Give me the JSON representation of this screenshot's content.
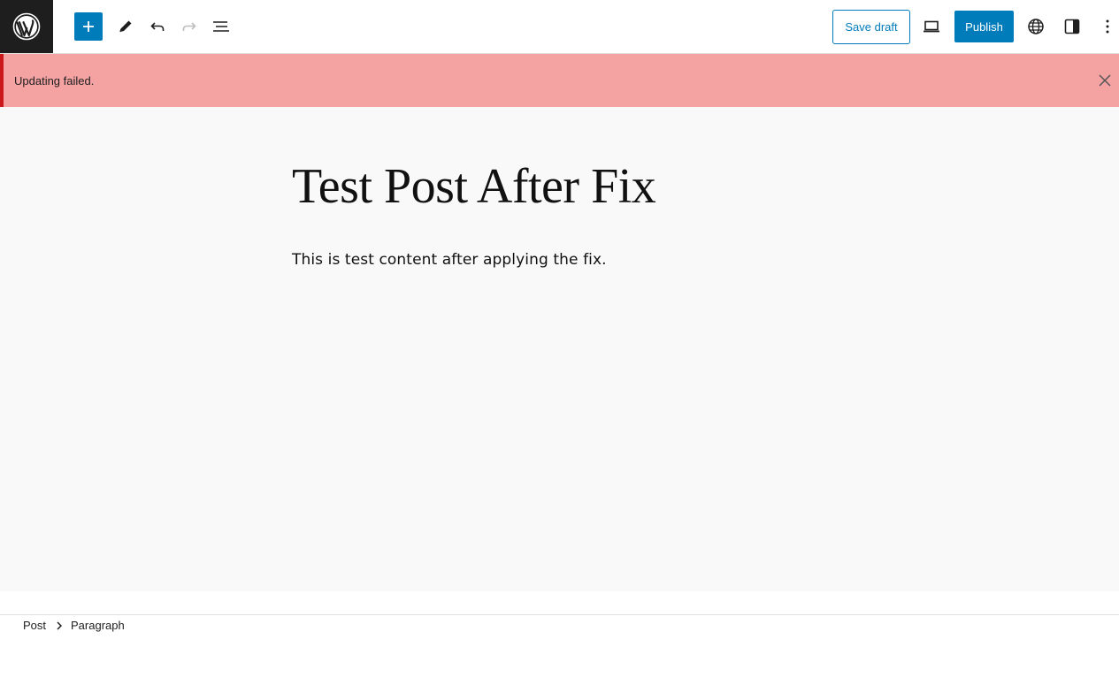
{
  "toolbar": {
    "logo_icon": "wordpress-logo-icon",
    "add_block_icon": "plus-icon",
    "tools_icon": "pencil-icon",
    "undo_icon": "undo-icon",
    "redo_icon": "redo-icon",
    "document_overview_icon": "list-view-icon",
    "save_draft_label": "Save draft",
    "preview_icon": "laptop-icon",
    "publish_label": "Publish",
    "view_site_icon": "globe-icon",
    "settings_icon": "sidebar-toggle-icon",
    "options_icon": "more-vertical-icon",
    "accent_color": "#007cba"
  },
  "notice": {
    "message": "Updating failed.",
    "status": "error",
    "background_color": "#f4a2a2",
    "border_color": "#cc1818",
    "close_icon": "close-icon"
  },
  "editor": {
    "title": "Test Post After Fix",
    "paragraph": "This is test content after applying the fix."
  },
  "footer": {
    "breadcrumb": [
      "Post",
      "Paragraph"
    ],
    "separator_icon": "chevron-right-icon"
  }
}
